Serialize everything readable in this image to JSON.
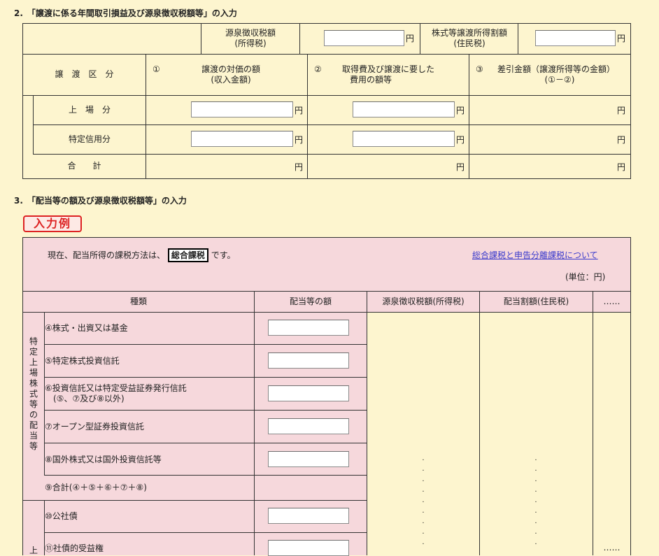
{
  "section2": {
    "title": "2.　「譲渡に係る年間取引損益及び源泉徴収税額等」の入力",
    "withholding_label": "源泉徴収税額",
    "withholding_sub": "(所得税)",
    "local_label": "株式等譲渡所得割額",
    "local_sub": "(住民税)",
    "col_category": "譲　渡　区　分",
    "col1_num": "①",
    "col1_label": "譲渡の対価の額",
    "col1_sub": "(収入金額)",
    "col2_num": "②",
    "col2_label": "取得費及び譲渡に要した",
    "col2_sub": "費用の額等",
    "col3_num": "③",
    "col3_label": "差引金額（譲渡所得等の金額）",
    "col3_sub": "(①－②)",
    "row_listed": "上　場　分",
    "row_special": "特定信用分",
    "row_total": "合　　計",
    "yen": "円"
  },
  "section3": {
    "title": "3.　「配当等の額及び源泉徴収税額等」の入力",
    "example_badge": "入力例",
    "method_prefix": "現在、配当所得の課税方法は、",
    "method_value": "総合課税",
    "method_suffix": "です。",
    "link_text": "総合課税と申告分離課税について",
    "unit": "(単位：円)",
    "col_type": "種類",
    "col_amount": "配当等の額",
    "col_withholding": "源泉徴収税額(所得税)",
    "col_local": "配当割額(住民税)",
    "col_more": "……",
    "group1_label": "特定上場株式等の配当等",
    "group2_label": "上",
    "rows": [
      {
        "label": "④株式・出資又は基金"
      },
      {
        "label": "⑤特定株式投資信託"
      },
      {
        "label": "⑥投資信託又は特定受益証券発行信託",
        "sub": "(⑤、⑦及び⑧以外)"
      },
      {
        "label": "⑦オープン型証券投資信託"
      },
      {
        "label": "⑧国外株式又は国外投資信託等"
      },
      {
        "label": "⑨合計(④＋⑤＋⑥＋⑦＋⑧)"
      },
      {
        "label": "⑩公社債"
      },
      {
        "label": "⑪社債的受益権"
      }
    ],
    "more_bottom": "……"
  }
}
